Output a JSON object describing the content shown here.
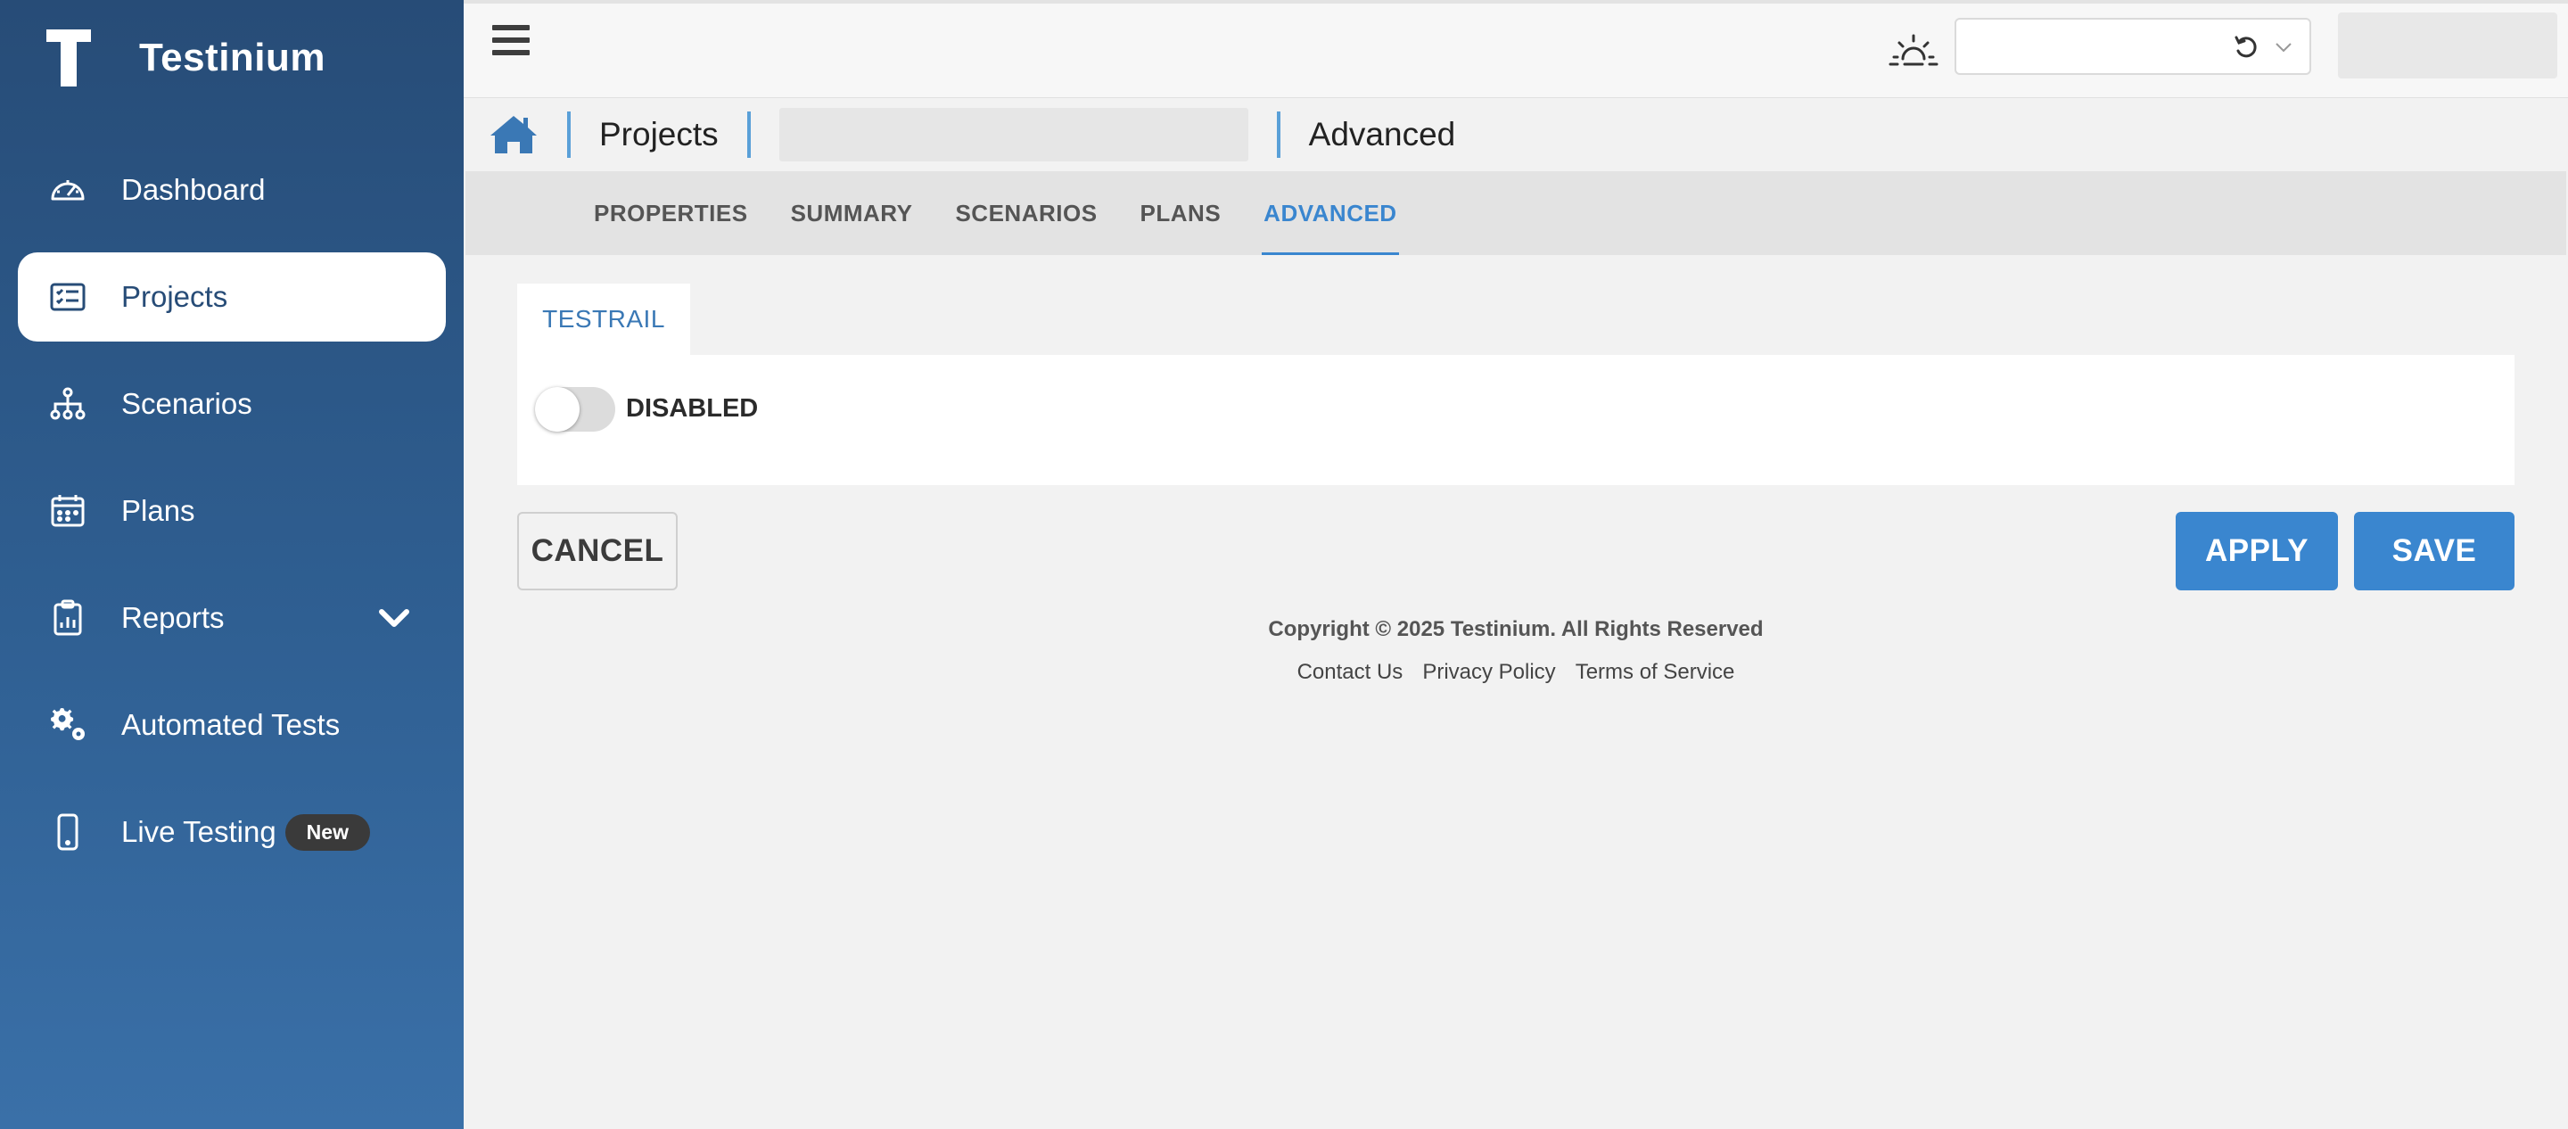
{
  "brand": {
    "name": "Testinium"
  },
  "sidebar": {
    "items": [
      {
        "label": "Dashboard",
        "icon": "dashboard-gauge-icon"
      },
      {
        "label": "Projects",
        "icon": "projects-list-icon",
        "active": true
      },
      {
        "label": "Scenarios",
        "icon": "scenarios-tree-icon"
      },
      {
        "label": "Plans",
        "icon": "plans-calendar-icon"
      },
      {
        "label": "Reports",
        "icon": "reports-clipboard-icon",
        "expandable": true
      },
      {
        "label": "Automated Tests",
        "icon": "gears-icon"
      },
      {
        "label": "Live Testing",
        "icon": "mobile-phone-icon",
        "badge": "New"
      }
    ]
  },
  "topbar": {
    "menu_icon": "hamburger-icon",
    "theme_icon": "sunrise-icon",
    "select_value": ""
  },
  "breadcrumb": {
    "section": "Projects",
    "project": "",
    "page": "Advanced"
  },
  "tabs": [
    {
      "label": "PROPERTIES"
    },
    {
      "label": "SUMMARY"
    },
    {
      "label": "SCENARIOS"
    },
    {
      "label": "PLANS"
    },
    {
      "label": "ADVANCED",
      "active": true
    }
  ],
  "integration": {
    "tab_label": "TESTRAIL",
    "toggle_label": "DISABLED",
    "enabled": false
  },
  "actions": {
    "cancel": "CANCEL",
    "apply": "APPLY",
    "save": "SAVE"
  },
  "footer": {
    "copyright": "Copyright © 2025 Testinium. All Rights Reserved",
    "links": [
      "Contact Us",
      "Privacy Policy",
      "Terms of Service"
    ]
  },
  "colors": {
    "sidebar": "#2f5f92",
    "accent": "#3a86cf"
  }
}
